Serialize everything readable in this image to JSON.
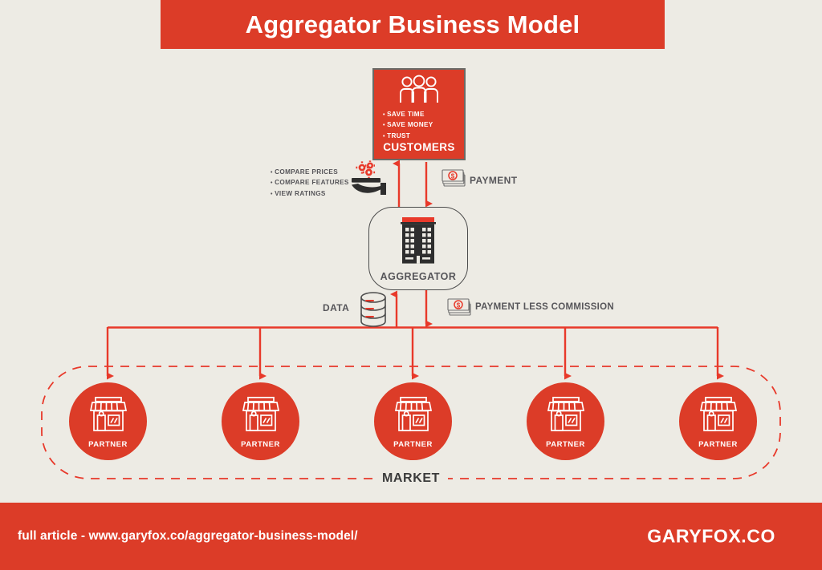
{
  "colors": {
    "background": "#EDEBE4",
    "brand_red": "#DC3C28",
    "dark_gray": "#3B3B3B",
    "text_gray": "#57565A",
    "white": "#FFFFFF"
  },
  "header": {
    "title": "Aggregator Business Model"
  },
  "customers": {
    "label": "CUSTOMERS",
    "icon": "three-people-icon",
    "benefits": [
      "SAVE TIME",
      "SAVE MONEY",
      "TRUST"
    ]
  },
  "customer_activities": {
    "icon": "hand-with-gears-icon",
    "items": [
      "COMPARE PRICES",
      "COMPARE FEATURES",
      "VIEW RATINGS"
    ]
  },
  "payment": {
    "label": "PAYMENT",
    "icon": "banknote-icon"
  },
  "aggregator": {
    "label": "AGGREGATOR",
    "icon": "office-building-icon"
  },
  "data_flow": {
    "label": "DATA",
    "icon": "database-icon"
  },
  "commission_flow": {
    "label": "PAYMENT LESS COMMISSION",
    "icon": "banknote-icon"
  },
  "market": {
    "label": "MARKET",
    "partners": [
      {
        "label": "PARTNER",
        "icon": "storefront-icon"
      },
      {
        "label": "PARTNER",
        "icon": "storefront-icon"
      },
      {
        "label": "PARTNER",
        "icon": "storefront-icon"
      },
      {
        "label": "PARTNER",
        "icon": "storefront-icon"
      },
      {
        "label": "PARTNER",
        "icon": "storefront-icon"
      }
    ]
  },
  "footer": {
    "article": "full article - www.garyfox.co/aggregator-business-model/",
    "brand": "GARYFOX.CO"
  }
}
